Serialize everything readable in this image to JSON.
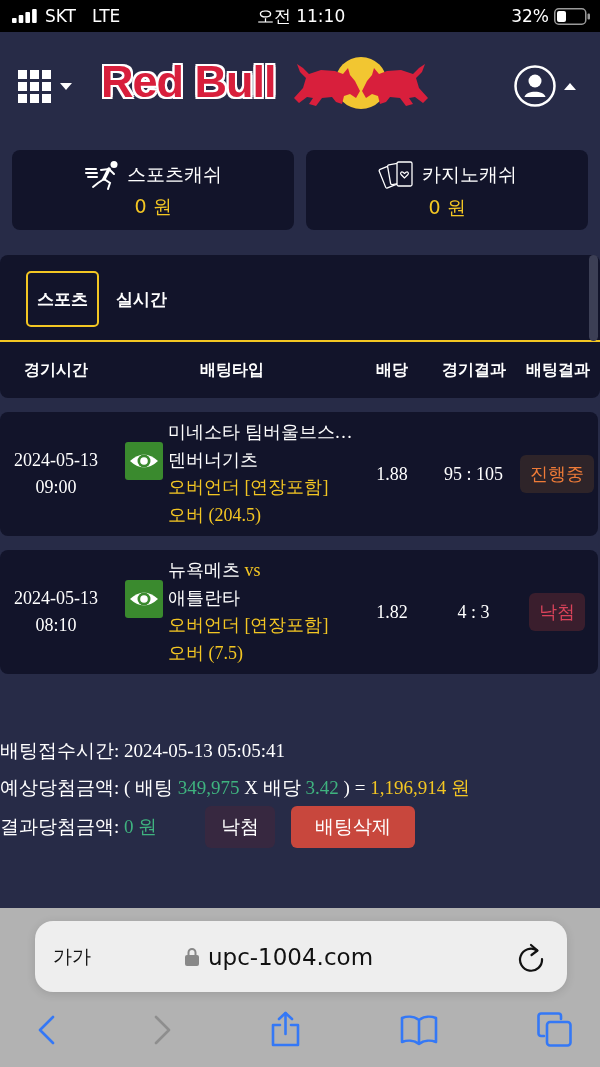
{
  "status_bar": {
    "carrier": "SKT",
    "network": "LTE",
    "time": "오전 11:10",
    "battery": "32%"
  },
  "header": {
    "logo": "Red Bull"
  },
  "wallets": [
    {
      "kind": "sports",
      "label": "스포츠캐쉬",
      "amount": "0 원"
    },
    {
      "kind": "casino",
      "label": "카지노캐쉬",
      "amount": "0 원"
    }
  ],
  "tabs": [
    {
      "label": "스포츠",
      "selected": true
    },
    {
      "label": "실시간",
      "selected": false
    }
  ],
  "table": {
    "columns": [
      "경기시간",
      "배팅타입",
      "배당",
      "경기결과",
      "배팅결과"
    ],
    "rows": [
      {
        "date": "2024-05-13",
        "time": "09:00",
        "home": "미네소타 팀버울브스…",
        "away": "덴버너기츠",
        "market": "오버언더 [연장포함]",
        "pick": "오버 (204.5)",
        "odds": "1.88",
        "score": "95 : 105",
        "result": {
          "label": "진행중",
          "kind": "in_progress"
        }
      },
      {
        "date": "2024-05-13",
        "time": "08:10",
        "home": "뉴욕메츠",
        "vs": "vs",
        "away": "애틀란타",
        "market": "오버언더 [연장포함]",
        "pick": "오버 (7.5)",
        "odds": "1.82",
        "score": "4 : 3",
        "result": {
          "label": "낙첨",
          "kind": "lost"
        }
      }
    ]
  },
  "summary": {
    "received": "배팅접수시간: 2024-05-13 05:05:41",
    "expected": {
      "label": "예상당첨금액: ( 배팅",
      "stake": "349,975",
      "mid": "X 배당",
      "odds": "3.42",
      "equals": ") =",
      "payout": "1,196,914 원"
    },
    "result": {
      "label": "결과당첨금액:",
      "amount": "0 원"
    },
    "buttons": [
      {
        "kind": "status",
        "label": "낙첨"
      },
      {
        "kind": "delete",
        "label": "배팅삭제"
      }
    ]
  },
  "browser": {
    "text_size": "가가",
    "url": "upc-1004.com",
    "toolbar": [
      {
        "kind": "back",
        "disabled": false
      },
      {
        "kind": "forward",
        "disabled": true
      },
      {
        "kind": "share",
        "disabled": false
      },
      {
        "kind": "bookmarks",
        "disabled": false
      },
      {
        "kind": "tabs",
        "disabled": false
      }
    ]
  }
}
